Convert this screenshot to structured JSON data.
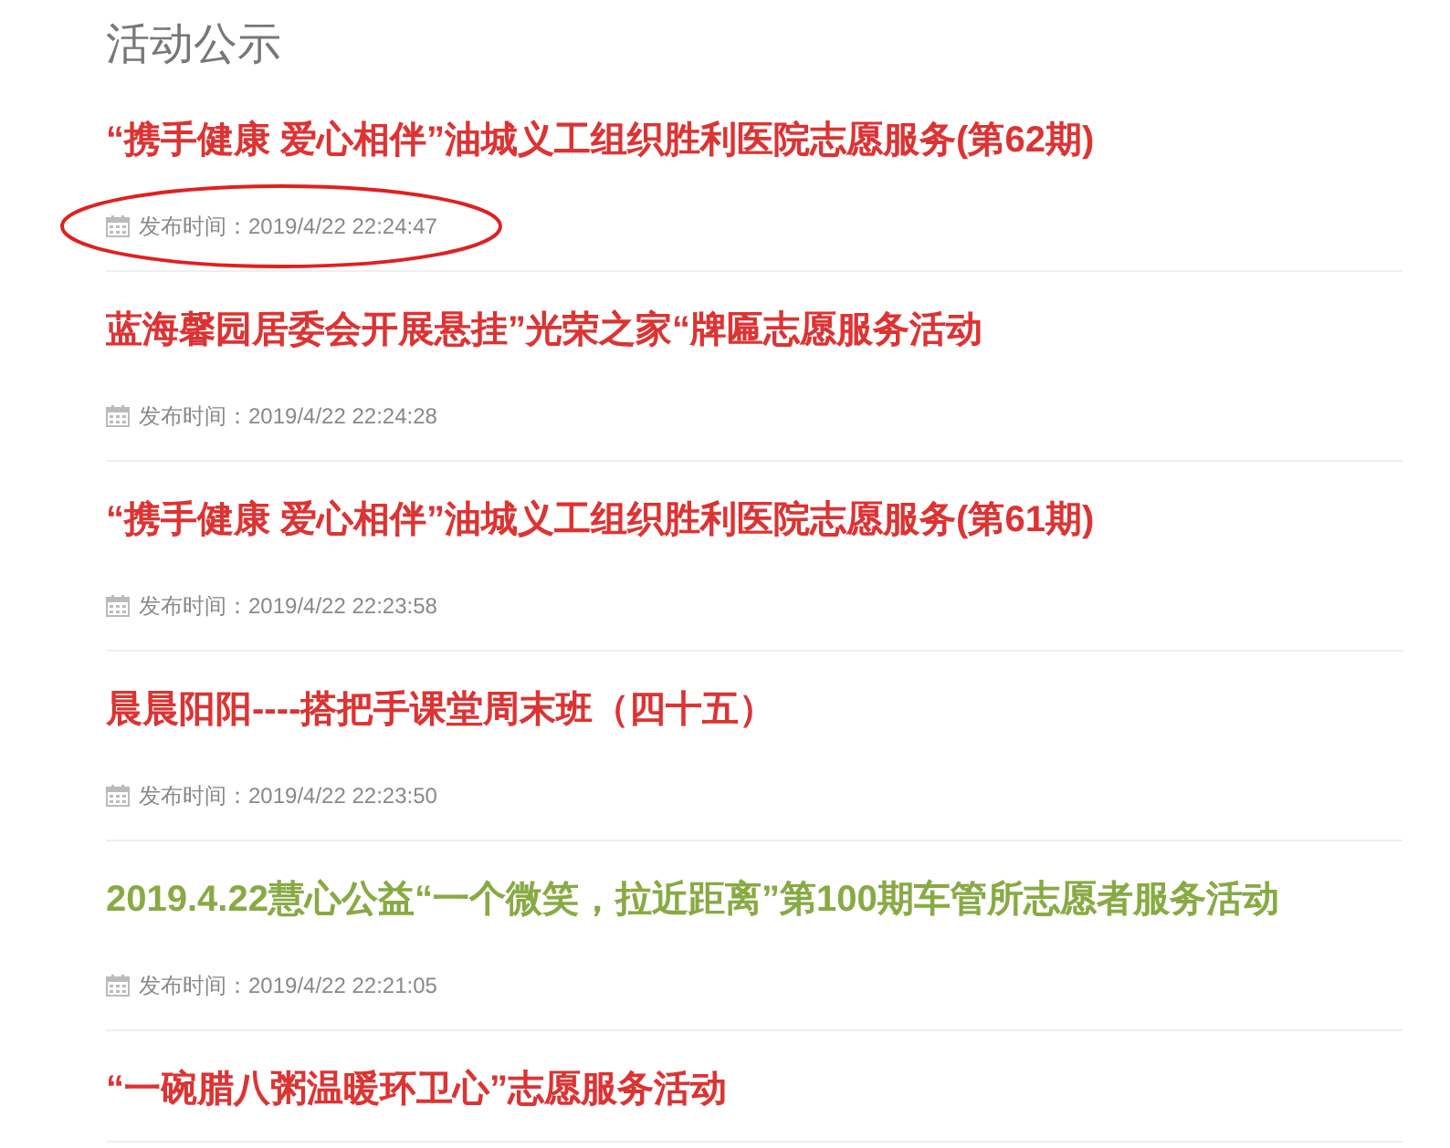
{
  "heading": "活动公示",
  "items": [
    {
      "title": "“携手健康 爱心相伴”油城义工组织胜利医院志愿服务(第62期)",
      "color": "#dd3333",
      "meta": "发布时间：2019/4/22 22:24:47",
      "circled": true
    },
    {
      "title": "蓝海馨园居委会开展悬挂”光荣之家“牌匾志愿服务活动",
      "color": "#dd3333",
      "meta": "发布时间：2019/4/22 22:24:28",
      "circled": false
    },
    {
      "title": "“携手健康 爱心相伴”油城义工组织胜利医院志愿服务(第61期)",
      "color": "#dd3333",
      "meta": "发布时间：2019/4/22 22:23:58",
      "circled": false
    },
    {
      "title": "晨晨阳阳----搭把手课堂周末班（四十五）",
      "color": "#dd3333",
      "meta": "发布时间：2019/4/22 22:23:50",
      "circled": false
    },
    {
      "title": "2019.4.22慧心公益“一个微笑，拉近距离”第100期车管所志愿者服务活动",
      "color": "#88aa44",
      "meta": "发布时间：2019/4/22 22:21:05",
      "circled": false
    },
    {
      "title": "“一碗腊八粥温暖环卫心”志愿服务活动",
      "color": "#dd3333"
    }
  ]
}
